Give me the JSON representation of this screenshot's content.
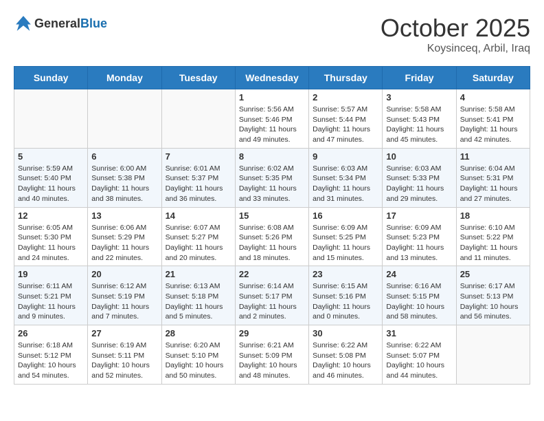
{
  "header": {
    "logo_general": "General",
    "logo_blue": "Blue",
    "month": "October 2025",
    "location": "Koysinceq, Arbil, Iraq"
  },
  "days_of_week": [
    "Sunday",
    "Monday",
    "Tuesday",
    "Wednesday",
    "Thursday",
    "Friday",
    "Saturday"
  ],
  "weeks": [
    [
      {
        "day": "",
        "info": ""
      },
      {
        "day": "",
        "info": ""
      },
      {
        "day": "",
        "info": ""
      },
      {
        "day": "1",
        "info": "Sunrise: 5:56 AM\nSunset: 5:46 PM\nDaylight: 11 hours and 49 minutes."
      },
      {
        "day": "2",
        "info": "Sunrise: 5:57 AM\nSunset: 5:44 PM\nDaylight: 11 hours and 47 minutes."
      },
      {
        "day": "3",
        "info": "Sunrise: 5:58 AM\nSunset: 5:43 PM\nDaylight: 11 hours and 45 minutes."
      },
      {
        "day": "4",
        "info": "Sunrise: 5:58 AM\nSunset: 5:41 PM\nDaylight: 11 hours and 42 minutes."
      }
    ],
    [
      {
        "day": "5",
        "info": "Sunrise: 5:59 AM\nSunset: 5:40 PM\nDaylight: 11 hours and 40 minutes."
      },
      {
        "day": "6",
        "info": "Sunrise: 6:00 AM\nSunset: 5:38 PM\nDaylight: 11 hours and 38 minutes."
      },
      {
        "day": "7",
        "info": "Sunrise: 6:01 AM\nSunset: 5:37 PM\nDaylight: 11 hours and 36 minutes."
      },
      {
        "day": "8",
        "info": "Sunrise: 6:02 AM\nSunset: 5:35 PM\nDaylight: 11 hours and 33 minutes."
      },
      {
        "day": "9",
        "info": "Sunrise: 6:03 AM\nSunset: 5:34 PM\nDaylight: 11 hours and 31 minutes."
      },
      {
        "day": "10",
        "info": "Sunrise: 6:03 AM\nSunset: 5:33 PM\nDaylight: 11 hours and 29 minutes."
      },
      {
        "day": "11",
        "info": "Sunrise: 6:04 AM\nSunset: 5:31 PM\nDaylight: 11 hours and 27 minutes."
      }
    ],
    [
      {
        "day": "12",
        "info": "Sunrise: 6:05 AM\nSunset: 5:30 PM\nDaylight: 11 hours and 24 minutes."
      },
      {
        "day": "13",
        "info": "Sunrise: 6:06 AM\nSunset: 5:29 PM\nDaylight: 11 hours and 22 minutes."
      },
      {
        "day": "14",
        "info": "Sunrise: 6:07 AM\nSunset: 5:27 PM\nDaylight: 11 hours and 20 minutes."
      },
      {
        "day": "15",
        "info": "Sunrise: 6:08 AM\nSunset: 5:26 PM\nDaylight: 11 hours and 18 minutes."
      },
      {
        "day": "16",
        "info": "Sunrise: 6:09 AM\nSunset: 5:25 PM\nDaylight: 11 hours and 15 minutes."
      },
      {
        "day": "17",
        "info": "Sunrise: 6:09 AM\nSunset: 5:23 PM\nDaylight: 11 hours and 13 minutes."
      },
      {
        "day": "18",
        "info": "Sunrise: 6:10 AM\nSunset: 5:22 PM\nDaylight: 11 hours and 11 minutes."
      }
    ],
    [
      {
        "day": "19",
        "info": "Sunrise: 6:11 AM\nSunset: 5:21 PM\nDaylight: 11 hours and 9 minutes."
      },
      {
        "day": "20",
        "info": "Sunrise: 6:12 AM\nSunset: 5:19 PM\nDaylight: 11 hours and 7 minutes."
      },
      {
        "day": "21",
        "info": "Sunrise: 6:13 AM\nSunset: 5:18 PM\nDaylight: 11 hours and 5 minutes."
      },
      {
        "day": "22",
        "info": "Sunrise: 6:14 AM\nSunset: 5:17 PM\nDaylight: 11 hours and 2 minutes."
      },
      {
        "day": "23",
        "info": "Sunrise: 6:15 AM\nSunset: 5:16 PM\nDaylight: 11 hours and 0 minutes."
      },
      {
        "day": "24",
        "info": "Sunrise: 6:16 AM\nSunset: 5:15 PM\nDaylight: 10 hours and 58 minutes."
      },
      {
        "day": "25",
        "info": "Sunrise: 6:17 AM\nSunset: 5:13 PM\nDaylight: 10 hours and 56 minutes."
      }
    ],
    [
      {
        "day": "26",
        "info": "Sunrise: 6:18 AM\nSunset: 5:12 PM\nDaylight: 10 hours and 54 minutes."
      },
      {
        "day": "27",
        "info": "Sunrise: 6:19 AM\nSunset: 5:11 PM\nDaylight: 10 hours and 52 minutes."
      },
      {
        "day": "28",
        "info": "Sunrise: 6:20 AM\nSunset: 5:10 PM\nDaylight: 10 hours and 50 minutes."
      },
      {
        "day": "29",
        "info": "Sunrise: 6:21 AM\nSunset: 5:09 PM\nDaylight: 10 hours and 48 minutes."
      },
      {
        "day": "30",
        "info": "Sunrise: 6:22 AM\nSunset: 5:08 PM\nDaylight: 10 hours and 46 minutes."
      },
      {
        "day": "31",
        "info": "Sunrise: 6:22 AM\nSunset: 5:07 PM\nDaylight: 10 hours and 44 minutes."
      },
      {
        "day": "",
        "info": ""
      }
    ]
  ]
}
